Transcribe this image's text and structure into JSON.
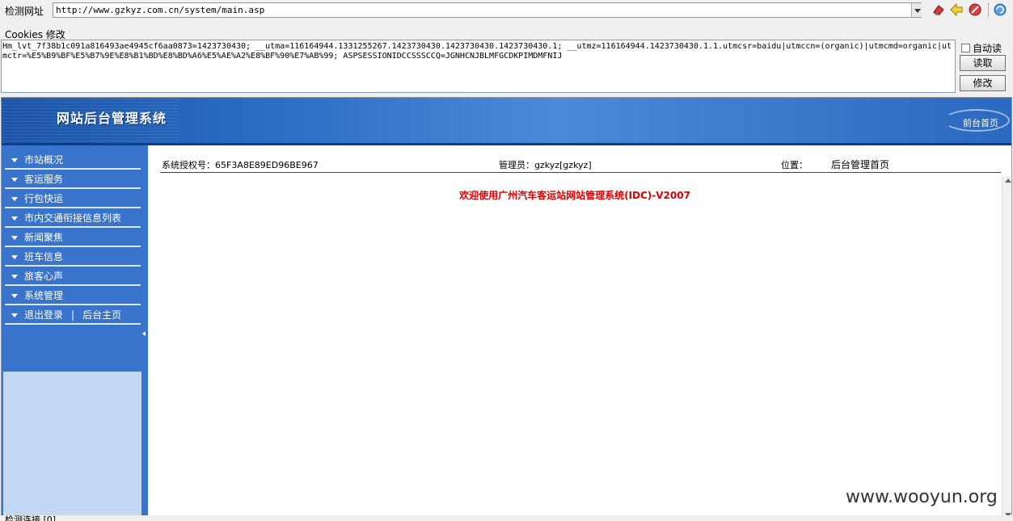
{
  "toolbar": {
    "url_label": "检测网址",
    "url_value": "http://www.gzkyz.com.cn/system/main.asp",
    "icons": [
      "eraser-icon",
      "back-arrow-icon",
      "stop-icon",
      "refresh-icon"
    ]
  },
  "cookies": {
    "label": "Cookies 修改",
    "value": "Hm_lvt_7f38b1c091a816493ae4945cf6aa0873=1423730430; __utma=116164944.1331255267.1423730430.1423730430.1423730430.1; __utmz=116164944.1423730430.1.1.utmcsr=baidu|utmccn=(organic)|utmcmd=organic|utmctr=%E5%B9%BF%E5%B7%9E%E8%B1%BD%E8%BD%A6%E5%AE%A2%E8%BF%90%E7%AB%99; ASPSESSIONIDCCSSSCCQ=JGNHCNJBLMFGCDKPIMDMFNIJ",
    "auto_read_label": "自动读",
    "read_button": "读取",
    "modify_button": "修改"
  },
  "site": {
    "banner_title": "网站后台管理系统",
    "front_page_link": "前台首页",
    "menu": [
      "市站概况",
      "客运服务",
      "行包快运",
      "市内交通衔接信息列表",
      "新闻聚焦",
      "班车信息",
      "旅客心声",
      "系统管理"
    ],
    "logout": "退出登录",
    "separator": "|",
    "admin_home": "后台主页",
    "license_label": "系统授权号：65F3A8E89ED96BE967",
    "admin_label": "管理员：gzkyz[gzkyz]",
    "location_label": "位置：",
    "location_value": "后台管理首页",
    "welcome_text": "欢迎使用广州汽车客运站网站管理系统(IDC)-V2007"
  },
  "watermark": "www.wooyun.org",
  "status_text": "检测连接 [0]"
}
